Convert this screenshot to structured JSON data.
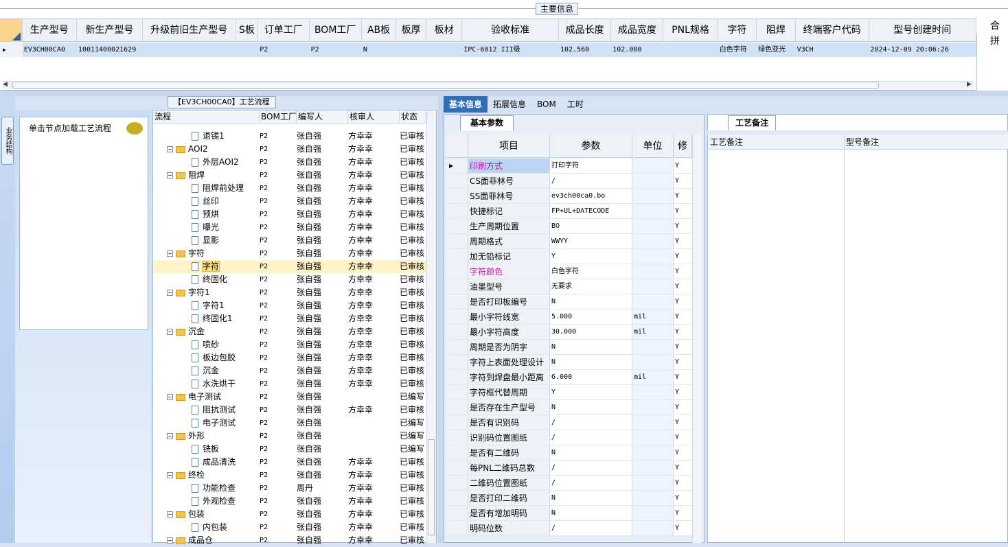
{
  "main_info": {
    "title": "主要信息",
    "columns": [
      "生产型号",
      "新生产型号",
      "升级前旧生产型号",
      "S板",
      "订单工厂",
      "BOM工厂",
      "AB板",
      "板厚",
      "板材",
      "验收标准",
      "成品长度",
      "成品宽度",
      "PNL规格",
      "字符",
      "阻焊",
      "终端客户代码",
      "型号创建时间"
    ],
    "extra_column": "合拼",
    "row": [
      "EV3CH00CA0",
      "10011400021629",
      "",
      "",
      "P2",
      "P2",
      "N",
      "",
      "",
      "IPC-6012 III级",
      "102.560",
      "102.000",
      "",
      "白色字符",
      "绿色亚光",
      "V3CH",
      "2024-12-09 20:06:26"
    ]
  },
  "left_nav": {
    "tab_label": "业务结构",
    "load_text": "单击节点加载工艺流程"
  },
  "flow": {
    "title": "【EV3CH00CA0】工艺流程",
    "columns": [
      "流程",
      "BOM工厂",
      "编写人",
      "核审人",
      "状态"
    ],
    "rows": [
      {
        "name": "退锡1",
        "factory": "P2",
        "writer": "张自强",
        "reviewer": "方幸幸",
        "status": "已审核",
        "level": 2
      },
      {
        "name": "AOI2",
        "factory": "P2",
        "writer": "张自强",
        "reviewer": "方幸幸",
        "status": "已审核",
        "level": 1
      },
      {
        "name": "外层AOI2",
        "factory": "P2",
        "writer": "张自强",
        "reviewer": "方幸幸",
        "status": "已审核",
        "level": 2
      },
      {
        "name": "阻焊",
        "factory": "P2",
        "writer": "张自强",
        "reviewer": "方幸幸",
        "status": "已审核",
        "level": 1
      },
      {
        "name": "阻焊前处理",
        "factory": "P2",
        "writer": "张自强",
        "reviewer": "方幸幸",
        "status": "已审核",
        "level": 2
      },
      {
        "name": "丝印",
        "factory": "P2",
        "writer": "张自强",
        "reviewer": "方幸幸",
        "status": "已审核",
        "level": 2
      },
      {
        "name": "预烘",
        "factory": "P2",
        "writer": "张自强",
        "reviewer": "方幸幸",
        "status": "已审核",
        "level": 2
      },
      {
        "name": "曝光",
        "factory": "P2",
        "writer": "张自强",
        "reviewer": "方幸幸",
        "status": "已审核",
        "level": 2
      },
      {
        "name": "显影",
        "factory": "P2",
        "writer": "张自强",
        "reviewer": "方幸幸",
        "status": "已审核",
        "level": 2
      },
      {
        "name": "字符",
        "factory": "P2",
        "writer": "张自强",
        "reviewer": "方幸幸",
        "status": "已审核",
        "level": 1
      },
      {
        "name": "字符",
        "factory": "P2",
        "writer": "张自强",
        "reviewer": "方幸幸",
        "status": "已审核",
        "level": 2,
        "selected": true
      },
      {
        "name": "终固化",
        "factory": "P2",
        "writer": "张自强",
        "reviewer": "方幸幸",
        "status": "已审核",
        "level": 2
      },
      {
        "name": "字符1",
        "factory": "P2",
        "writer": "张自强",
        "reviewer": "方幸幸",
        "status": "已审核",
        "level": 1
      },
      {
        "name": "字符1",
        "factory": "P2",
        "writer": "张自强",
        "reviewer": "方幸幸",
        "status": "已审核",
        "level": 2
      },
      {
        "name": "终固化1",
        "factory": "P2",
        "writer": "张自强",
        "reviewer": "方幸幸",
        "status": "已审核",
        "level": 2
      },
      {
        "name": "沉金",
        "factory": "P2",
        "writer": "张自强",
        "reviewer": "方幸幸",
        "status": "已审核",
        "level": 1
      },
      {
        "name": "喷砂",
        "factory": "P2",
        "writer": "张自强",
        "reviewer": "方幸幸",
        "status": "已审核",
        "level": 2
      },
      {
        "name": "板边包胶",
        "factory": "P2",
        "writer": "张自强",
        "reviewer": "方幸幸",
        "status": "已审核",
        "level": 2
      },
      {
        "name": "沉金",
        "factory": "P2",
        "writer": "张自强",
        "reviewer": "方幸幸",
        "status": "已审核",
        "level": 2
      },
      {
        "name": "水洗烘干",
        "factory": "P2",
        "writer": "张自强",
        "reviewer": "方幸幸",
        "status": "已审核",
        "level": 2
      },
      {
        "name": "电子测试",
        "factory": "P2",
        "writer": "张自强",
        "reviewer": "",
        "status": "已编写",
        "level": 1
      },
      {
        "name": "阻抗测试",
        "factory": "P2",
        "writer": "张自强",
        "reviewer": "方幸幸",
        "status": "已审核",
        "level": 2
      },
      {
        "name": "电子测试",
        "factory": "P2",
        "writer": "张自强",
        "reviewer": "",
        "status": "已编写",
        "level": 2
      },
      {
        "name": "外形",
        "factory": "P2",
        "writer": "张自强",
        "reviewer": "",
        "status": "已编写",
        "level": 1
      },
      {
        "name": "铣板",
        "factory": "P2",
        "writer": "张自强",
        "reviewer": "",
        "status": "已编写",
        "level": 2
      },
      {
        "name": "成品清洗",
        "factory": "P2",
        "writer": "张自强",
        "reviewer": "方幸幸",
        "status": "已审核",
        "level": 2
      },
      {
        "name": "终检",
        "factory": "P2",
        "writer": "张自强",
        "reviewer": "方幸幸",
        "status": "已审核",
        "level": 1
      },
      {
        "name": "功能检查",
        "factory": "P2",
        "writer": "周丹",
        "reviewer": "方幸幸",
        "status": "已审核",
        "level": 2
      },
      {
        "name": "外观检查",
        "factory": "P2",
        "writer": "张自强",
        "reviewer": "方幸幸",
        "status": "已审核",
        "level": 2
      },
      {
        "name": "包装",
        "factory": "P2",
        "writer": "张自强",
        "reviewer": "方幸幸",
        "status": "已审核",
        "level": 1
      },
      {
        "name": "内包装",
        "factory": "P2",
        "writer": "张自强",
        "reviewer": "方幸幸",
        "status": "已审核",
        "level": 2
      },
      {
        "name": "成品仓",
        "factory": "P2",
        "writer": "张自强",
        "reviewer": "方幸幸",
        "status": "已审核",
        "level": 1
      }
    ]
  },
  "right_tabs": [
    "基本信息",
    "拓展信息",
    "BOM",
    "工时"
  ],
  "basic": {
    "tab": "基本参数",
    "columns": [
      "项目",
      "参数",
      "单位",
      "修"
    ],
    "rows": [
      {
        "item": "印刷方式",
        "value": "打印字符",
        "unit": "",
        "mod": "Y",
        "pink": true
      },
      {
        "item": "CS面菲林号",
        "value": "/",
        "unit": "",
        "mod": "Y"
      },
      {
        "item": "SS面菲林号",
        "value": "ev3ch00ca0.bo",
        "unit": "",
        "mod": "Y"
      },
      {
        "item": "快捷标记",
        "value": "FP+UL+DATECODE",
        "unit": "",
        "mod": "Y"
      },
      {
        "item": "生产周期位置",
        "value": "BO",
        "unit": "",
        "mod": "Y"
      },
      {
        "item": "周期格式",
        "value": "WWYY",
        "unit": "",
        "mod": "Y"
      },
      {
        "item": "加无铅标记",
        "value": "Y",
        "unit": "",
        "mod": "Y"
      },
      {
        "item": "字符颜色",
        "value": "白色字符",
        "unit": "",
        "mod": "Y",
        "pink": true
      },
      {
        "item": "油墨型号",
        "value": "无要求",
        "unit": "",
        "mod": "Y"
      },
      {
        "item": "是否打印板编号",
        "value": "N",
        "unit": "",
        "mod": "Y"
      },
      {
        "item": "最小字符线宽",
        "value": "5.000",
        "unit": "mil",
        "mod": "Y"
      },
      {
        "item": "最小字符高度",
        "value": "30.000",
        "unit": "mil",
        "mod": "Y"
      },
      {
        "item": "周期是否为阴字",
        "value": "N",
        "unit": "",
        "mod": "Y"
      },
      {
        "item": "字符上表面处理设计",
        "value": "N",
        "unit": "",
        "mod": "Y"
      },
      {
        "item": "字符到焊盘最小距离",
        "value": "6.000",
        "unit": "mil",
        "mod": "Y"
      },
      {
        "item": "字符框代替周期",
        "value": "Y",
        "unit": "",
        "mod": "Y"
      },
      {
        "item": "是否存在生产型号",
        "value": "N",
        "unit": "",
        "mod": "Y"
      },
      {
        "item": "是否有识别码",
        "value": "/",
        "unit": "",
        "mod": "Y"
      },
      {
        "item": "识别码位置图纸",
        "value": "/",
        "unit": "",
        "mod": "Y"
      },
      {
        "item": "是否有二维码",
        "value": "N",
        "unit": "",
        "mod": "Y"
      },
      {
        "item": "每PNL二维码总数",
        "value": "/",
        "unit": "",
        "mod": "Y"
      },
      {
        "item": "二维码位置图纸",
        "value": "/",
        "unit": "",
        "mod": "Y"
      },
      {
        "item": "是否打印二维码",
        "value": "N",
        "unit": "",
        "mod": "Y"
      },
      {
        "item": "是否有增加明码",
        "value": "N",
        "unit": "",
        "mod": "Y"
      },
      {
        "item": "明码位数",
        "value": "/",
        "unit": "",
        "mod": "Y"
      }
    ]
  },
  "remark": {
    "tab": "工艺备注",
    "col1": "工艺备注",
    "col2": "型号备注"
  },
  "colors": {
    "selection": "#cfe2f7",
    "tab_active": "#2f6fb9",
    "pink": "#c0149a"
  }
}
